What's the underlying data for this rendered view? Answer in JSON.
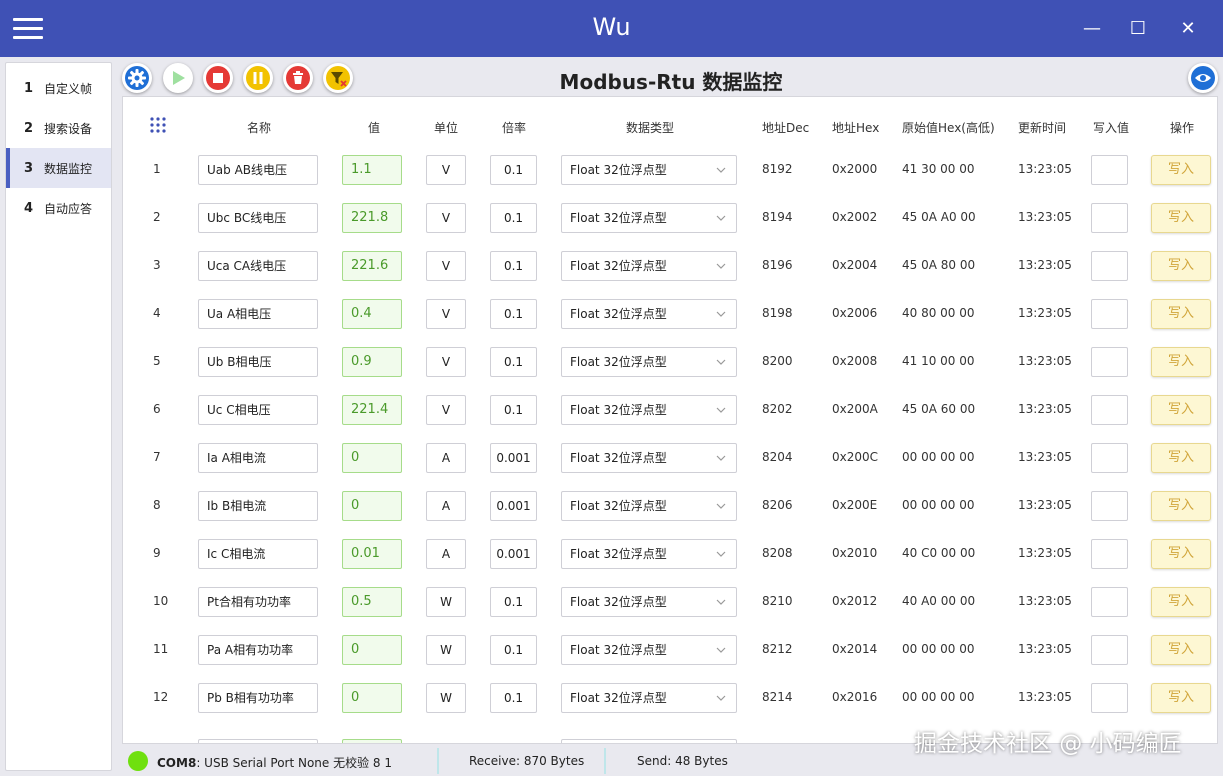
{
  "window": {
    "title": "Wu",
    "minimize": "—",
    "maximize": "☐",
    "close": "✕"
  },
  "sidebar": {
    "items": [
      {
        "num": "1",
        "label": "自定义帧",
        "active": false
      },
      {
        "num": "2",
        "label": "搜索设备",
        "active": false
      },
      {
        "num": "3",
        "label": "数据监控",
        "active": true
      },
      {
        "num": "4",
        "label": "自动应答",
        "active": false
      }
    ]
  },
  "toolbar": {
    "buttons": [
      {
        "name": "settings-button",
        "icon": "gear-icon",
        "color": "#1f6fd6"
      },
      {
        "name": "play-button",
        "icon": "play-icon",
        "color": "#9fe0a0"
      },
      {
        "name": "stop-button",
        "icon": "stop-icon",
        "color": "#e53935"
      },
      {
        "name": "pause-button",
        "icon": "pause-icon",
        "color": "#f2c200"
      },
      {
        "name": "delete-button",
        "icon": "trash-icon",
        "color": "#e53935"
      },
      {
        "name": "clear-filter-button",
        "icon": "filter-clear-icon",
        "color": "#f2c200"
      }
    ],
    "view_icon": "eye-icon"
  },
  "page_title": "Modbus-Rtu 数据监控",
  "table": {
    "headers": {
      "name": "名称",
      "value": "值",
      "unit": "单位",
      "ratio": "倍率",
      "dtype": "数据类型",
      "addr_dec": "地址Dec",
      "addr_hex": "地址Hex",
      "raw": "原始值Hex(高低)",
      "time": "更新时间",
      "write_val": "写入值",
      "op": "操作"
    },
    "rows": [
      {
        "idx": "1",
        "name": "Uab AB线电压",
        "value": "1.1",
        "unit": "V",
        "ratio": "0.1",
        "dtype": "Float 32位浮点型",
        "addr_dec": "8192",
        "addr_hex": "0x2000",
        "raw": "41 30 00 00",
        "time": "13:23:05",
        "btn": "写入"
      },
      {
        "idx": "2",
        "name": "Ubc BC线电压",
        "value": "221.8",
        "unit": "V",
        "ratio": "0.1",
        "dtype": "Float 32位浮点型",
        "addr_dec": "8194",
        "addr_hex": "0x2002",
        "raw": "45 0A A0 00",
        "time": "13:23:05",
        "btn": "写入"
      },
      {
        "idx": "3",
        "name": "Uca CA线电压",
        "value": "221.6",
        "unit": "V",
        "ratio": "0.1",
        "dtype": "Float 32位浮点型",
        "addr_dec": "8196",
        "addr_hex": "0x2004",
        "raw": "45 0A 80 00",
        "time": "13:23:05",
        "btn": "写入"
      },
      {
        "idx": "4",
        "name": "Ua A相电压",
        "value": "0.4",
        "unit": "V",
        "ratio": "0.1",
        "dtype": "Float 32位浮点型",
        "addr_dec": "8198",
        "addr_hex": "0x2006",
        "raw": "40 80 00 00",
        "time": "13:23:05",
        "btn": "写入"
      },
      {
        "idx": "5",
        "name": "Ub B相电压",
        "value": "0.9",
        "unit": "V",
        "ratio": "0.1",
        "dtype": "Float 32位浮点型",
        "addr_dec": "8200",
        "addr_hex": "0x2008",
        "raw": "41 10 00 00",
        "time": "13:23:05",
        "btn": "写入"
      },
      {
        "idx": "6",
        "name": "Uc C相电压",
        "value": "221.4",
        "unit": "V",
        "ratio": "0.1",
        "dtype": "Float 32位浮点型",
        "addr_dec": "8202",
        "addr_hex": "0x200A",
        "raw": "45 0A 60 00",
        "time": "13:23:05",
        "btn": "写入"
      },
      {
        "idx": "7",
        "name": "Ia A相电流",
        "value": "0",
        "unit": "A",
        "ratio": "0.001",
        "dtype": "Float 32位浮点型",
        "addr_dec": "8204",
        "addr_hex": "0x200C",
        "raw": "00 00 00 00",
        "time": "13:23:05",
        "btn": "写入"
      },
      {
        "idx": "8",
        "name": "Ib B相电流",
        "value": "0",
        "unit": "A",
        "ratio": "0.001",
        "dtype": "Float 32位浮点型",
        "addr_dec": "8206",
        "addr_hex": "0x200E",
        "raw": "00 00 00 00",
        "time": "13:23:05",
        "btn": "写入"
      },
      {
        "idx": "9",
        "name": "Ic C相电流",
        "value": "0.01",
        "unit": "A",
        "ratio": "0.001",
        "dtype": "Float 32位浮点型",
        "addr_dec": "8208",
        "addr_hex": "0x2010",
        "raw": "40 C0 00 00",
        "time": "13:23:05",
        "btn": "写入"
      },
      {
        "idx": "10",
        "name": "Pt合相有功功率",
        "value": "0.5",
        "unit": "W",
        "ratio": "0.1",
        "dtype": "Float 32位浮点型",
        "addr_dec": "8210",
        "addr_hex": "0x2012",
        "raw": "40 A0 00 00",
        "time": "13:23:05",
        "btn": "写入"
      },
      {
        "idx": "11",
        "name": "Pa A相有功功率",
        "value": "0",
        "unit": "W",
        "ratio": "0.1",
        "dtype": "Float 32位浮点型",
        "addr_dec": "8212",
        "addr_hex": "0x2014",
        "raw": "00 00 00 00",
        "time": "13:23:05",
        "btn": "写入"
      },
      {
        "idx": "12",
        "name": "Pb B相有功功率",
        "value": "0",
        "unit": "W",
        "ratio": "0.1",
        "dtype": "Float 32位浮点型",
        "addr_dec": "8214",
        "addr_hex": "0x2016",
        "raw": "00 00 00 00",
        "time": "13:23:05",
        "btn": "写入"
      }
    ]
  },
  "status": {
    "port": "COM8",
    "port_desc": ": USB Serial Port  None   无校验  8  1",
    "receive": "Receive: 870 Bytes",
    "send": "Send: 48 Bytes"
  },
  "watermark": "掘金技术社区 @ 小码编匠"
}
